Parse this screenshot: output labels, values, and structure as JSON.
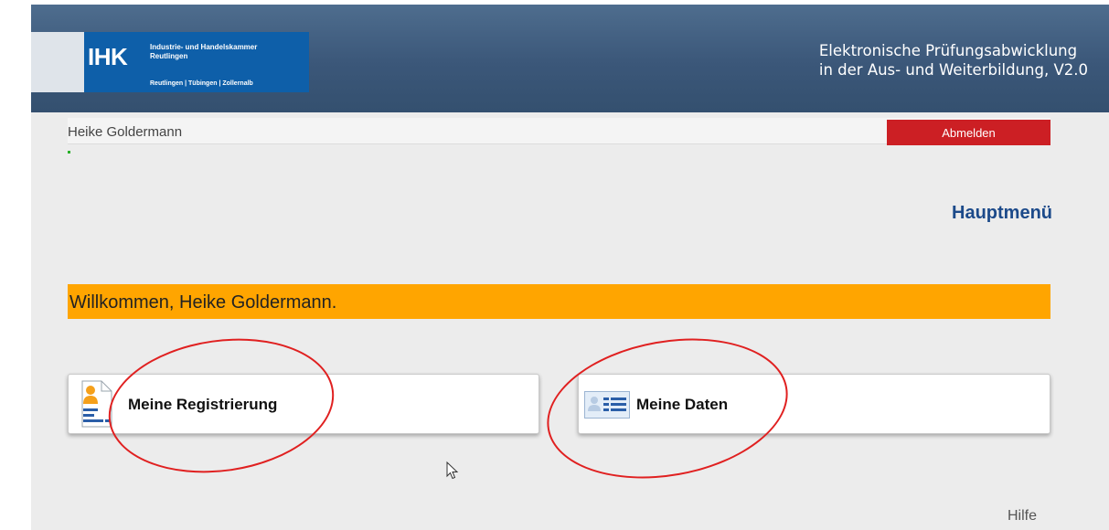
{
  "header": {
    "logo": {
      "abbr": "IHK",
      "org_line1": "Industrie- und Handelskammer",
      "org_line2": "Reutlingen",
      "cities": "Reutlingen | Tübingen | Zollernalb"
    },
    "app_title_line1": "Elektronische Prüfungsabwicklung",
    "app_title_line2": "in der Aus- und Weiterbildung, V2.0"
  },
  "userbar": {
    "username": "Heike Goldermann",
    "logout_label": "Abmelden"
  },
  "main": {
    "page_title": "Hauptmenü",
    "welcome": "Willkommen, Heike Goldermann.",
    "cards": [
      {
        "label": "Meine Registrierung",
        "icon": "registration-document-icon"
      },
      {
        "label": "Meine Daten",
        "icon": "personal-data-card-icon"
      }
    ]
  },
  "footer": {
    "help_label": "Hilfe"
  },
  "colors": {
    "header": "#3b5779",
    "logout": "#cc1f24",
    "welcome_bar": "#ffa500",
    "title": "#1c4a8a",
    "annotation": "#e02020"
  }
}
